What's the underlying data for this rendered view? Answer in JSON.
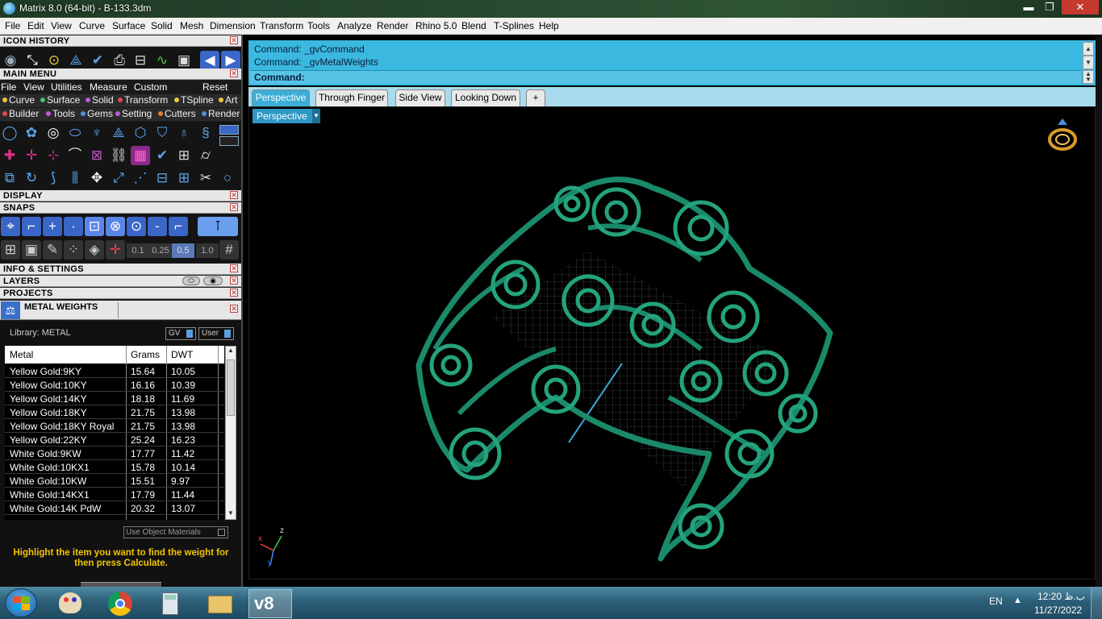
{
  "window": {
    "title": "Matrix 8.0 (64-bit) - B-133.3dm",
    "buttons": {
      "minimize": "▬",
      "maximize": "❐",
      "close": "✕"
    }
  },
  "menubar": [
    "File",
    "Edit",
    "View",
    "Curve",
    "Surface",
    "Solid",
    "Mesh",
    "Dimension",
    "Transform",
    "Tools",
    "Analyze",
    "Render",
    "Rhino 5.0",
    "Blend",
    "T-Splines",
    "Help"
  ],
  "sections": {
    "icon_history": "ICON HISTORY",
    "main_menu": "MAIN MENU",
    "display": "DISPLAY",
    "snaps": "SNAPS",
    "info_settings": "INFO & SETTINGS",
    "layers": "LAYERS",
    "projects": "PROJECTS",
    "metal_weights": "METAL WEIGHTS"
  },
  "main_menu": {
    "items": [
      "File",
      "View",
      "Utilities",
      "Measure",
      "Custom"
    ],
    "reset": "Reset",
    "categories_row1": [
      {
        "label": "Curve",
        "color": "#e8c840"
      },
      {
        "label": "Surface",
        "color": "#3fc46a"
      },
      {
        "label": "Solid",
        "color": "#c05ad8"
      },
      {
        "label": "Transform",
        "color": "#e04848"
      },
      {
        "label": "TSpline",
        "color": "#e8c840"
      },
      {
        "label": "Art",
        "color": "#e8c840"
      }
    ],
    "categories_row2": [
      {
        "label": "Builder",
        "color": "#e04848"
      },
      {
        "label": "Tools",
        "color": "#c05ad8"
      },
      {
        "label": "Gems",
        "color": "#4a90e0"
      },
      {
        "label": "Setting",
        "color": "#c05ad8"
      },
      {
        "label": "Cutters",
        "color": "#e07a30"
      },
      {
        "label": "Render",
        "color": "#4a90e0"
      }
    ]
  },
  "snaps": {
    "values": [
      "0.1",
      "0.25",
      "0.5",
      "1.0"
    ],
    "selected": "0.5"
  },
  "metal_weights": {
    "library_label": "Library: METAL",
    "gv_label": "GV",
    "user_label": "User",
    "columns": [
      "Metal",
      "Grams",
      "DWT"
    ],
    "rows": [
      [
        "Yellow Gold:9KY",
        "15.64",
        "10.05"
      ],
      [
        "Yellow Gold:10KY",
        "16.16",
        "10.39"
      ],
      [
        "Yellow Gold:14KY",
        "18.18",
        "11.69"
      ],
      [
        "Yellow Gold:18KY",
        "21.75",
        "13.98"
      ],
      [
        "Yellow Gold:18KY Royal",
        "21.75",
        "13.98"
      ],
      [
        "Yellow Gold:22KY",
        "25.24",
        "16.23"
      ],
      [
        "White Gold:9KW",
        "17.77",
        "11.42"
      ],
      [
        "White Gold:10KX1",
        "15.78",
        "10.14"
      ],
      [
        "White Gold:10KW",
        "15.51",
        "9.97"
      ],
      [
        "White Gold:14KX1",
        "17.79",
        "11.44"
      ],
      [
        "White Gold:14K PdW",
        "20.32",
        "13.07"
      ]
    ],
    "use_object_materials": "Use Object Materials",
    "hint": "Highlight the item you want to find the weight for then press Calculate."
  },
  "command": {
    "history": [
      "Command: _gvCommand",
      "Command: _gvMetalWeights"
    ],
    "prompt": "Command:"
  },
  "tabs": [
    "Perspective",
    "Through Finger",
    "Side View",
    "Looking Down"
  ],
  "tabs_add": "+",
  "viewport": {
    "label": "Perspective",
    "axes": {
      "x": "x",
      "y": "y",
      "z": "z"
    },
    "model_color": "#1a8a6a"
  },
  "taskbar": {
    "language": "EN",
    "time": "12:20 ب.ظ",
    "date": "11/27/2022"
  }
}
